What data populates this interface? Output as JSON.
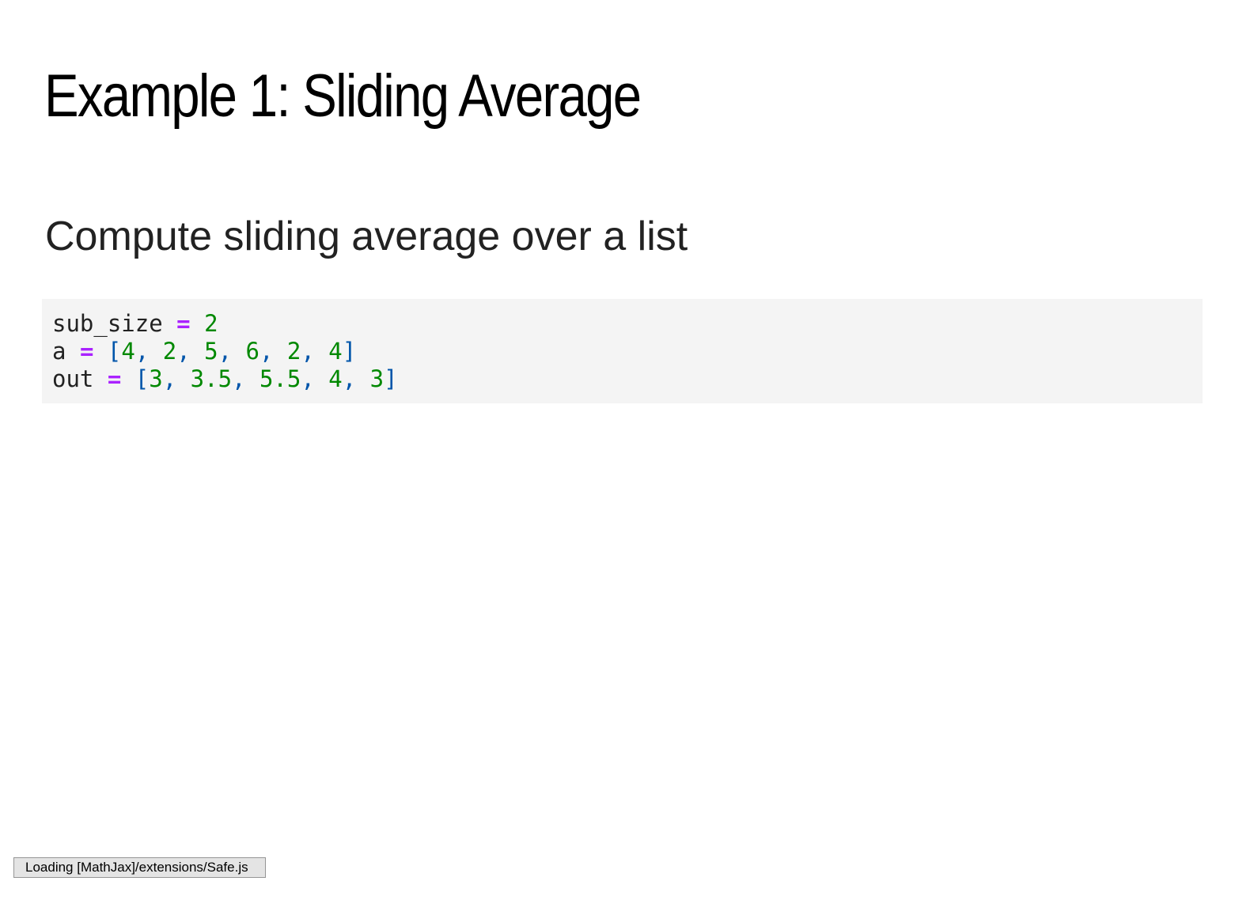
{
  "slide": {
    "title": "Example 1: Sliding Average",
    "subtitle": "Compute sliding average over a list"
  },
  "code": {
    "lines": [
      [
        {
          "type": "name",
          "text": "sub_size"
        },
        {
          "type": "space",
          "text": " "
        },
        {
          "type": "op",
          "text": "="
        },
        {
          "type": "space",
          "text": " "
        },
        {
          "type": "num",
          "text": "2"
        }
      ],
      [
        {
          "type": "name",
          "text": "a"
        },
        {
          "type": "space",
          "text": " "
        },
        {
          "type": "op",
          "text": "="
        },
        {
          "type": "space",
          "text": " "
        },
        {
          "type": "punct",
          "text": "["
        },
        {
          "type": "num",
          "text": "4"
        },
        {
          "type": "punct",
          "text": ", "
        },
        {
          "type": "num",
          "text": "2"
        },
        {
          "type": "punct",
          "text": ", "
        },
        {
          "type": "num",
          "text": "5"
        },
        {
          "type": "punct",
          "text": ", "
        },
        {
          "type": "num",
          "text": "6"
        },
        {
          "type": "punct",
          "text": ", "
        },
        {
          "type": "num",
          "text": "2"
        },
        {
          "type": "punct",
          "text": ", "
        },
        {
          "type": "num",
          "text": "4"
        },
        {
          "type": "punct",
          "text": "]"
        }
      ],
      [
        {
          "type": "name",
          "text": "out"
        },
        {
          "type": "space",
          "text": " "
        },
        {
          "type": "op",
          "text": "="
        },
        {
          "type": "space",
          "text": " "
        },
        {
          "type": "punct",
          "text": "["
        },
        {
          "type": "num",
          "text": "3"
        },
        {
          "type": "punct",
          "text": ", "
        },
        {
          "type": "num",
          "text": "3.5"
        },
        {
          "type": "punct",
          "text": ", "
        },
        {
          "type": "num",
          "text": "5.5"
        },
        {
          "type": "punct",
          "text": ", "
        },
        {
          "type": "num",
          "text": "4"
        },
        {
          "type": "punct",
          "text": ", "
        },
        {
          "type": "num",
          "text": "3"
        },
        {
          "type": "punct",
          "text": "]"
        }
      ]
    ]
  },
  "status": {
    "loading_text": "Loading [MathJax]/extensions/Safe.js"
  },
  "colors": {
    "code_background": "#f4f4f4",
    "operator": "#aa22ff",
    "number": "#008800",
    "punctuation": "#0055aa"
  }
}
